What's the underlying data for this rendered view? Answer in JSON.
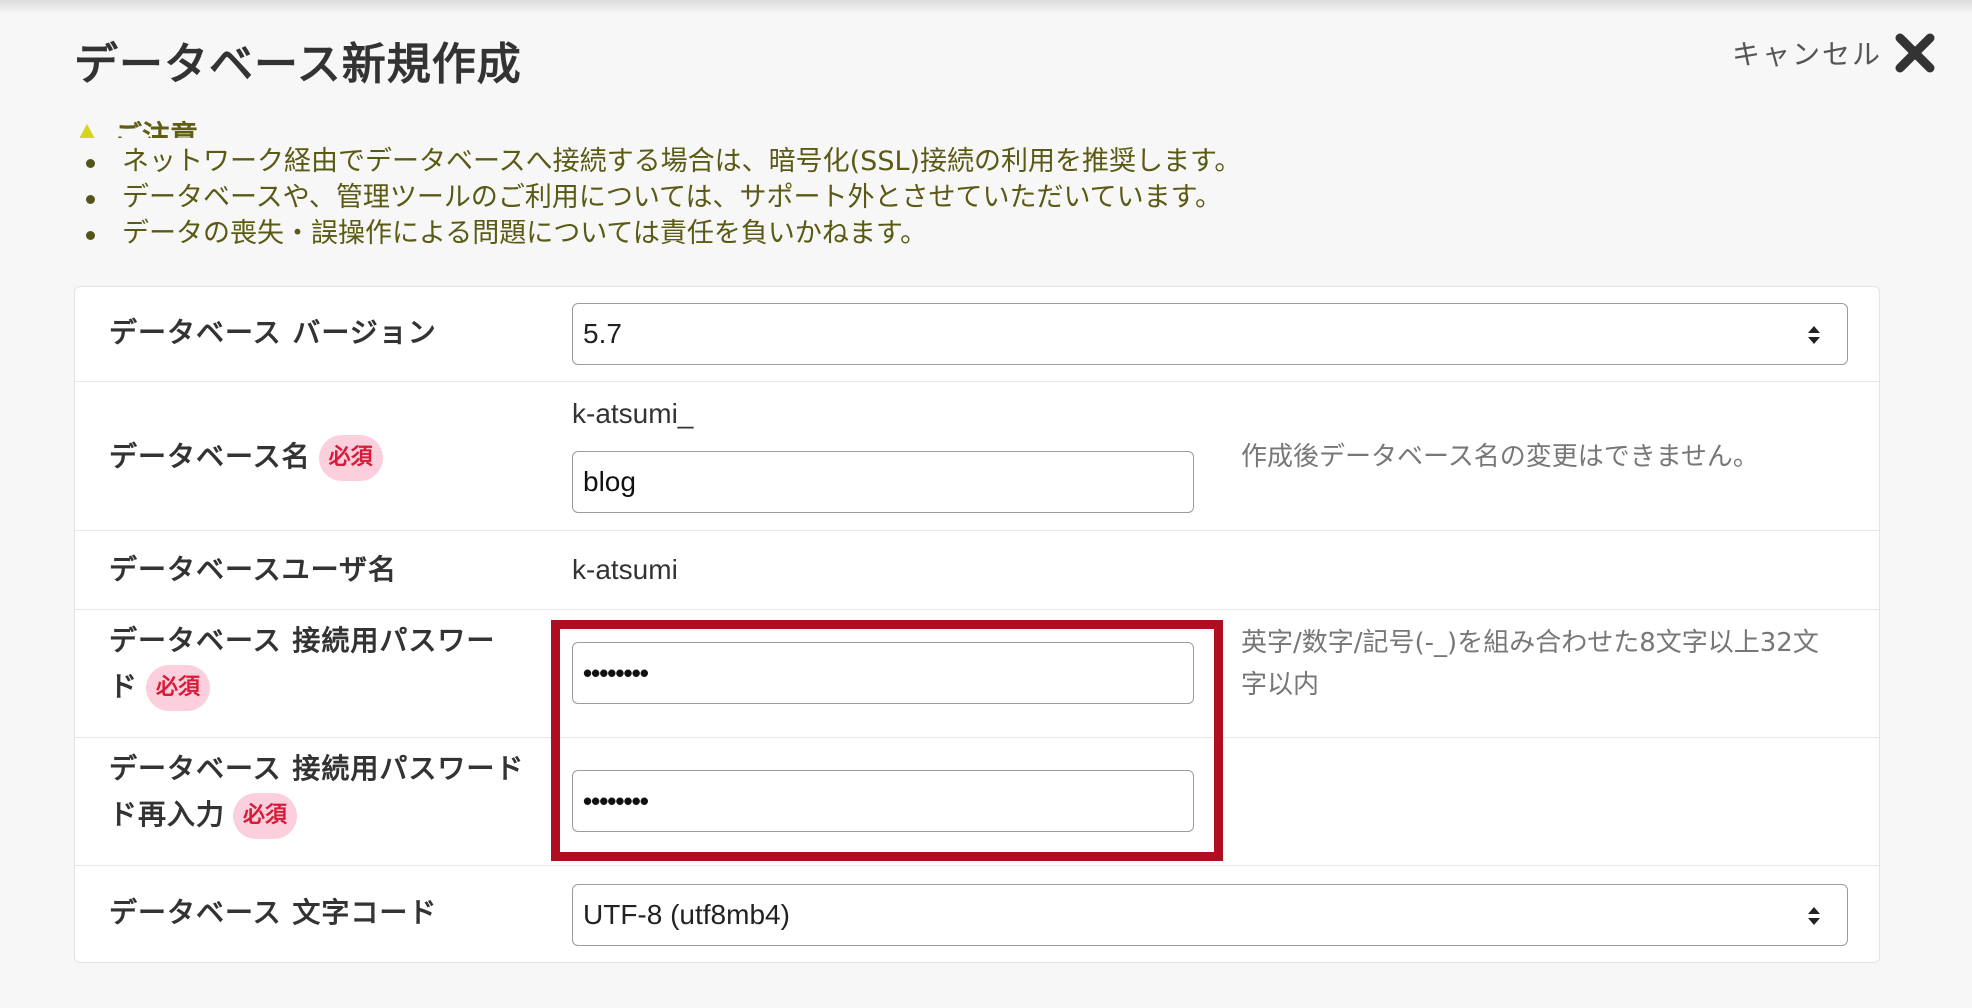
{
  "header": {
    "title": "データベース新規作成",
    "cancel_label": "キャンセル"
  },
  "notice": {
    "heading": "ご注意",
    "items": [
      "ネットワーク経由でデータベースへ接続する場合は、暗号化(SSL)接続の利用を推奨します。",
      "データベースや、管理ツールのご利用については、サポート外とさせていただいています。",
      "データの喪失・誤操作による問題については責任を負いかねます。"
    ]
  },
  "form": {
    "required_badge": "必須",
    "version": {
      "label": "データベース バージョン",
      "value": "5.7"
    },
    "db_name": {
      "label": "データベース名",
      "prefix": "k-atsumi_",
      "value": "blog",
      "hint": "作成後データベース名の変更はできません。"
    },
    "db_user": {
      "label": "データベースユーザ名",
      "value": "k-atsumi"
    },
    "password": {
      "label_line1": "データベース 接続用パスワー",
      "label_line2": "ド",
      "value": "••••••••",
      "hint_line1": "英字/数字/記号(-_)を組み合わせた8文字以上32文",
      "hint_line2": "字以内"
    },
    "password_confirm": {
      "label_line1": "データベース 接続用パスワード",
      "label_line2": "ド再入力",
      "value": "••••••••"
    },
    "charset": {
      "label": "データベース 文字コード",
      "value": "UTF-8 (utf8mb4)"
    }
  },
  "colors": {
    "highlight": "#b00c22",
    "required_bg": "#fbd0dc",
    "required_text": "#d81b3a",
    "notice_text": "#5a5a14"
  }
}
